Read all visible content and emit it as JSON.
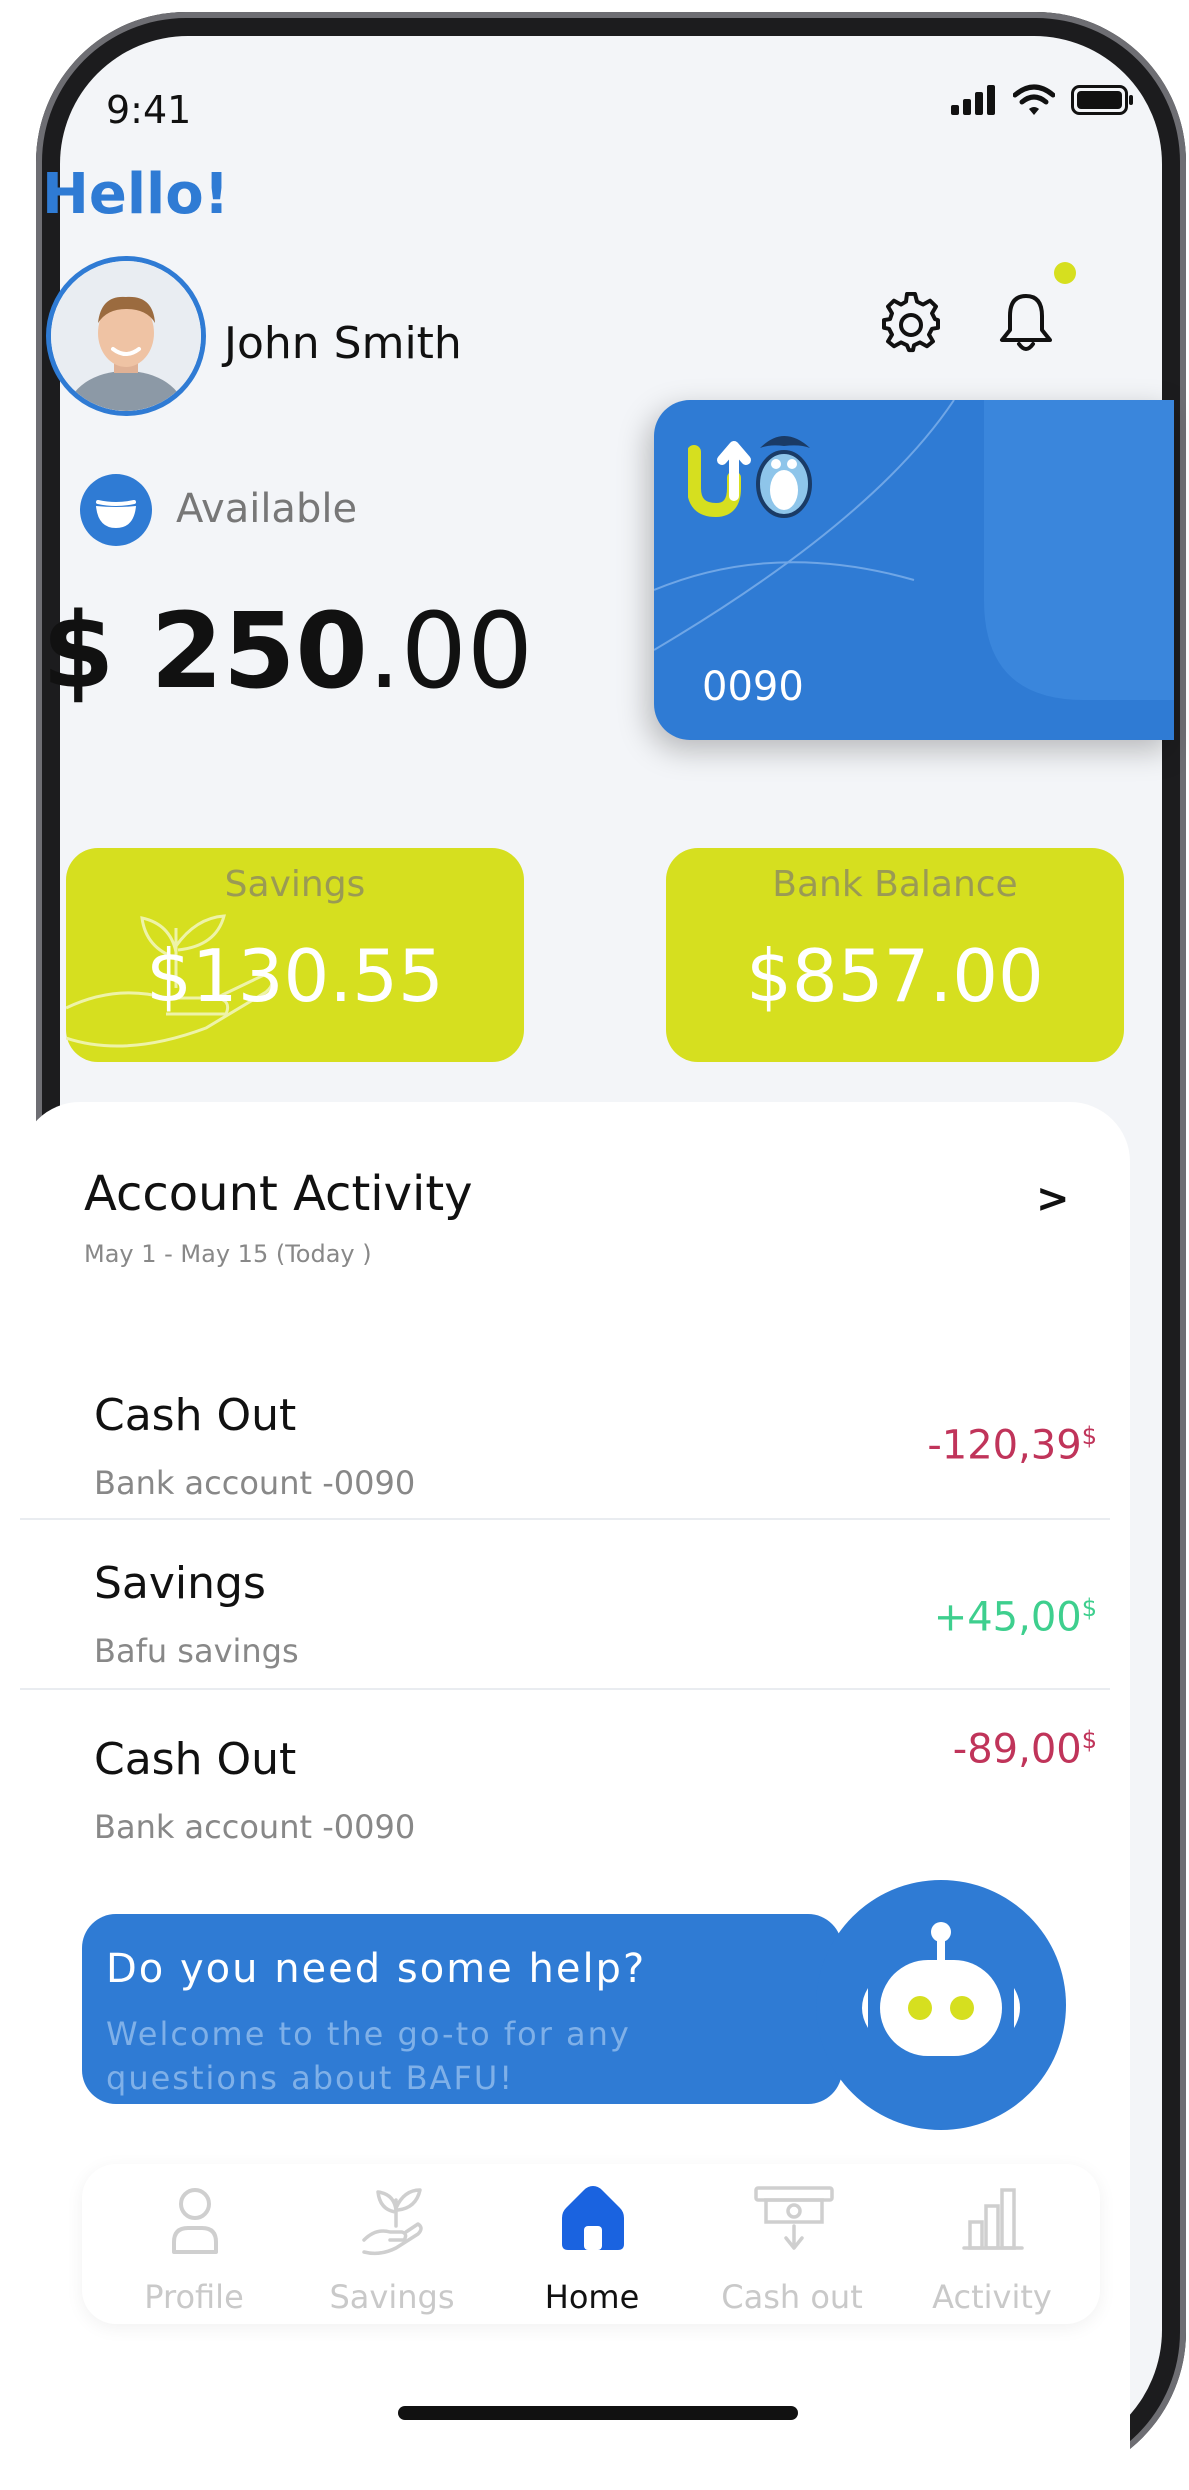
{
  "status": {
    "time": "9:41"
  },
  "header": {
    "greeting": "Hello!",
    "user_name": "John Smith"
  },
  "balance": {
    "label": "Available",
    "currency": "$",
    "whole": "250",
    "cents": ".00"
  },
  "card": {
    "number": "0090"
  },
  "tiles": [
    {
      "label": "Savings",
      "value": "$130.55"
    },
    {
      "label": "Bank Balance",
      "value": "$857.00"
    }
  ],
  "activity": {
    "title": "Account Activity",
    "range": "May 1 -   May  15  (Today )",
    "arrow": ">",
    "items": [
      {
        "title": "Cash Out",
        "subtitle": "Bank account -0090",
        "amount": "-120,39",
        "unit": "$",
        "kind": "negative"
      },
      {
        "title": "Savings",
        "subtitle": "Bafu savings",
        "amount": "+45,00",
        "unit": "$",
        "kind": "positive"
      },
      {
        "title": "Cash Out",
        "subtitle": "Bank account -0090",
        "amount": "-89,00",
        "unit": "$",
        "kind": "negative"
      }
    ]
  },
  "help": {
    "title": "Do you need some help?",
    "subtitle": "Welcome to the go-to for any questions about BAFU!"
  },
  "nav": {
    "items": [
      {
        "label": "Profile",
        "icon": "person-icon"
      },
      {
        "label": "Savings",
        "icon": "plant-hand-icon"
      },
      {
        "label": "Home",
        "icon": "home-icon",
        "active": true
      },
      {
        "label": "Cash out",
        "icon": "cash-out-icon"
      },
      {
        "label": "Activity",
        "icon": "bar-chart-icon"
      }
    ]
  },
  "colors": {
    "primary": "#2f7bd4",
    "accent": "#d6df1f",
    "negative": "#c0345a",
    "positive": "#3ecf8e"
  }
}
